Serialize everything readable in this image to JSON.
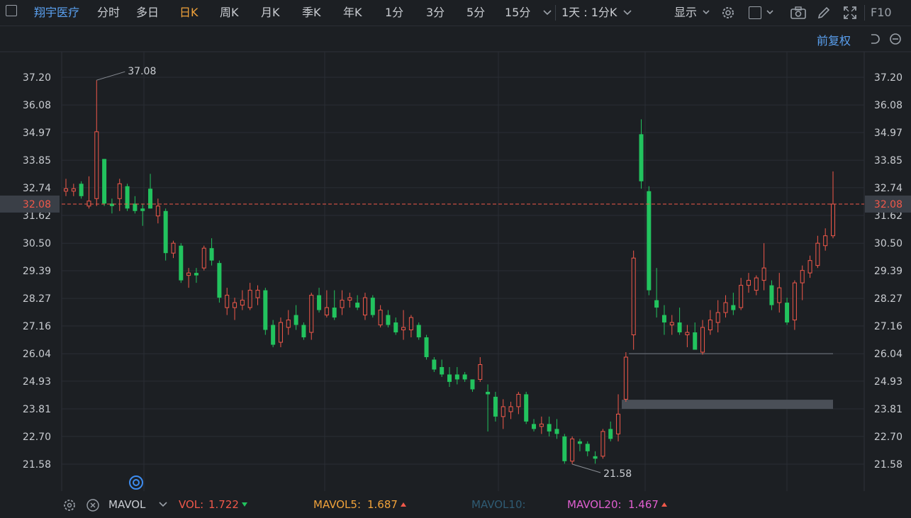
{
  "toolbar": {
    "stock_name": "翔宇医疗",
    "periods": [
      "分时",
      "多日",
      "日K",
      "周K",
      "月K",
      "季K",
      "年K",
      "1分",
      "3分",
      "5分",
      "15分"
    ],
    "active_period": "日K",
    "interval": "1天 : 1分K",
    "display_label": "显示",
    "f10_label": "F10"
  },
  "adjust_label": "前复权",
  "colors": {
    "background": "#1c1f23",
    "up": "#f0584a",
    "down": "#22c35e",
    "grid": "#2a2e34",
    "current_price": "#f0584a",
    "accent": "#f0a23a",
    "link": "#5aa0f0"
  },
  "chart_data": {
    "type": "candlestick",
    "y_ticks": [
      "37.20",
      "36.08",
      "34.97",
      "33.85",
      "32.74",
      "31.62",
      "30.50",
      "29.39",
      "28.27",
      "27.16",
      "26.04",
      "24.93",
      "23.81",
      "22.70",
      "21.58"
    ],
    "ylim": [
      20.7,
      38.3
    ],
    "current_price": "32.08",
    "high_label": "37.08",
    "low_label": "21.58",
    "support_bands": [
      [
        26.03,
        26.06
      ],
      [
        23.81,
        24.18
      ]
    ],
    "candles": [
      {
        "o": 32.6,
        "h": 33.1,
        "l": 32.4,
        "c": 32.7
      },
      {
        "o": 32.6,
        "h": 32.9,
        "l": 32.4,
        "c": 32.7
      },
      {
        "o": 32.9,
        "h": 33.0,
        "l": 32.3,
        "c": 32.4
      },
      {
        "o": 32.0,
        "h": 33.2,
        "l": 31.9,
        "c": 32.2
      },
      {
        "o": 32.3,
        "h": 37.08,
        "l": 32.0,
        "c": 35.0
      },
      {
        "o": 33.9,
        "h": 33.9,
        "l": 32.0,
        "c": 32.1
      },
      {
        "o": 32.1,
        "h": 32.3,
        "l": 31.7,
        "c": 32.0
      },
      {
        "o": 32.3,
        "h": 33.1,
        "l": 31.8,
        "c": 32.9
      },
      {
        "o": 32.8,
        "h": 32.9,
        "l": 31.8,
        "c": 31.9
      },
      {
        "o": 32.1,
        "h": 32.4,
        "l": 31.7,
        "c": 31.8
      },
      {
        "o": 31.9,
        "h": 32.1,
        "l": 31.2,
        "c": 31.8
      },
      {
        "o": 32.7,
        "h": 33.3,
        "l": 31.9,
        "c": 31.9
      },
      {
        "o": 31.6,
        "h": 32.3,
        "l": 31.3,
        "c": 32.0
      },
      {
        "o": 31.8,
        "h": 31.9,
        "l": 29.8,
        "c": 30.1
      },
      {
        "o": 30.1,
        "h": 30.6,
        "l": 29.9,
        "c": 30.5
      },
      {
        "o": 30.4,
        "h": 30.5,
        "l": 28.9,
        "c": 29.0
      },
      {
        "o": 29.2,
        "h": 29.5,
        "l": 28.7,
        "c": 29.3
      },
      {
        "o": 29.3,
        "h": 29.5,
        "l": 28.9,
        "c": 29.2
      },
      {
        "o": 29.5,
        "h": 30.4,
        "l": 29.4,
        "c": 30.3
      },
      {
        "o": 30.3,
        "h": 30.7,
        "l": 29.6,
        "c": 29.8
      },
      {
        "o": 29.7,
        "h": 29.8,
        "l": 28.1,
        "c": 28.3
      },
      {
        "o": 27.9,
        "h": 28.7,
        "l": 27.6,
        "c": 28.4
      },
      {
        "o": 27.9,
        "h": 28.3,
        "l": 27.4,
        "c": 28.1
      },
      {
        "o": 28.0,
        "h": 28.6,
        "l": 27.8,
        "c": 28.2
      },
      {
        "o": 27.9,
        "h": 28.9,
        "l": 27.8,
        "c": 28.6
      },
      {
        "o": 28.3,
        "h": 28.8,
        "l": 28.0,
        "c": 28.6
      },
      {
        "o": 28.6,
        "h": 28.7,
        "l": 26.8,
        "c": 27.0
      },
      {
        "o": 27.2,
        "h": 27.4,
        "l": 26.3,
        "c": 26.4
      },
      {
        "o": 26.5,
        "h": 27.5,
        "l": 26.3,
        "c": 27.3
      },
      {
        "o": 27.1,
        "h": 27.8,
        "l": 26.8,
        "c": 27.4
      },
      {
        "o": 27.6,
        "h": 28.0,
        "l": 27.0,
        "c": 27.2
      },
      {
        "o": 27.2,
        "h": 27.3,
        "l": 26.6,
        "c": 26.7
      },
      {
        "o": 26.9,
        "h": 28.5,
        "l": 26.6,
        "c": 28.4
      },
      {
        "o": 28.4,
        "h": 28.7,
        "l": 27.7,
        "c": 27.8
      },
      {
        "o": 27.6,
        "h": 28.6,
        "l": 27.5,
        "c": 27.9
      },
      {
        "o": 27.9,
        "h": 28.6,
        "l": 27.4,
        "c": 27.5
      },
      {
        "o": 27.9,
        "h": 28.6,
        "l": 27.6,
        "c": 28.2
      },
      {
        "o": 28.2,
        "h": 28.5,
        "l": 27.9,
        "c": 28.3
      },
      {
        "o": 28.1,
        "h": 28.4,
        "l": 27.8,
        "c": 27.9
      },
      {
        "o": 27.6,
        "h": 28.5,
        "l": 27.4,
        "c": 28.3
      },
      {
        "o": 28.3,
        "h": 28.4,
        "l": 27.5,
        "c": 27.6
      },
      {
        "o": 27.2,
        "h": 28.0,
        "l": 27.1,
        "c": 27.8
      },
      {
        "o": 27.6,
        "h": 27.8,
        "l": 27.1,
        "c": 27.2
      },
      {
        "o": 27.3,
        "h": 27.5,
        "l": 26.8,
        "c": 26.9
      },
      {
        "o": 27.0,
        "h": 27.8,
        "l": 26.6,
        "c": 27.1
      },
      {
        "o": 27.0,
        "h": 27.6,
        "l": 26.7,
        "c": 27.5
      },
      {
        "o": 27.2,
        "h": 27.3,
        "l": 26.6,
        "c": 26.7
      },
      {
        "o": 26.7,
        "h": 26.8,
        "l": 25.8,
        "c": 25.9
      },
      {
        "o": 25.8,
        "h": 25.9,
        "l": 25.3,
        "c": 25.4
      },
      {
        "o": 25.5,
        "h": 25.8,
        "l": 25.1,
        "c": 25.2
      },
      {
        "o": 25.2,
        "h": 25.5,
        "l": 24.7,
        "c": 24.9
      },
      {
        "o": 25.2,
        "h": 25.5,
        "l": 24.8,
        "c": 25.0
      },
      {
        "o": 25.2,
        "h": 25.3,
        "l": 24.9,
        "c": 25.0
      },
      {
        "o": 25.0,
        "h": 25.0,
        "l": 24.5,
        "c": 24.6
      },
      {
        "o": 25.0,
        "h": 25.9,
        "l": 24.9,
        "c": 25.6
      },
      {
        "o": 24.5,
        "h": 24.8,
        "l": 22.9,
        "c": 24.4
      },
      {
        "o": 24.3,
        "h": 24.5,
        "l": 23.3,
        "c": 23.5
      },
      {
        "o": 23.5,
        "h": 24.2,
        "l": 23.0,
        "c": 23.9
      },
      {
        "o": 23.7,
        "h": 24.1,
        "l": 23.4,
        "c": 23.9
      },
      {
        "o": 23.9,
        "h": 24.5,
        "l": 23.6,
        "c": 24.4
      },
      {
        "o": 24.4,
        "h": 24.5,
        "l": 23.2,
        "c": 23.3
      },
      {
        "o": 23.2,
        "h": 23.4,
        "l": 22.9,
        "c": 23.0
      },
      {
        "o": 23.1,
        "h": 23.5,
        "l": 22.8,
        "c": 23.2
      },
      {
        "o": 23.2,
        "h": 23.5,
        "l": 22.7,
        "c": 22.9
      },
      {
        "o": 23.0,
        "h": 23.4,
        "l": 22.6,
        "c": 22.8
      },
      {
        "o": 22.7,
        "h": 22.8,
        "l": 21.6,
        "c": 21.7
      },
      {
        "o": 21.7,
        "h": 22.7,
        "l": 21.58,
        "c": 22.6
      },
      {
        "o": 22.5,
        "h": 22.6,
        "l": 22.1,
        "c": 22.4
      },
      {
        "o": 22.4,
        "h": 22.5,
        "l": 21.9,
        "c": 22.1
      },
      {
        "o": 21.9,
        "h": 22.1,
        "l": 21.6,
        "c": 21.8
      },
      {
        "o": 21.9,
        "h": 23.0,
        "l": 21.8,
        "c": 22.9
      },
      {
        "o": 23.0,
        "h": 23.3,
        "l": 22.5,
        "c": 22.6
      },
      {
        "o": 22.8,
        "h": 24.4,
        "l": 22.5,
        "c": 23.6
      },
      {
        "o": 24.2,
        "h": 26.1,
        "l": 24.1,
        "c": 25.9
      },
      {
        "o": 26.8,
        "h": 30.2,
        "l": 26.2,
        "c": 29.9
      },
      {
        "o": 34.9,
        "h": 35.5,
        "l": 32.7,
        "c": 33.0
      },
      {
        "o": 32.6,
        "h": 32.8,
        "l": 28.4,
        "c": 28.6
      },
      {
        "o": 28.2,
        "h": 29.5,
        "l": 27.5,
        "c": 27.9
      },
      {
        "o": 27.6,
        "h": 28.0,
        "l": 26.8,
        "c": 27.3
      },
      {
        "o": 27.2,
        "h": 27.6,
        "l": 26.8,
        "c": 27.3
      },
      {
        "o": 27.3,
        "h": 27.9,
        "l": 26.8,
        "c": 26.9
      },
      {
        "o": 26.8,
        "h": 27.2,
        "l": 26.3,
        "c": 26.9
      },
      {
        "o": 26.9,
        "h": 27.3,
        "l": 26.2,
        "c": 26.2
      },
      {
        "o": 26.1,
        "h": 27.4,
        "l": 26.0,
        "c": 27.1
      },
      {
        "o": 27.0,
        "h": 27.8,
        "l": 26.8,
        "c": 27.4
      },
      {
        "o": 27.3,
        "h": 28.2,
        "l": 26.9,
        "c": 27.7
      },
      {
        "o": 27.7,
        "h": 28.4,
        "l": 27.5,
        "c": 28.1
      },
      {
        "o": 28.0,
        "h": 28.5,
        "l": 27.6,
        "c": 27.8
      },
      {
        "o": 27.9,
        "h": 29.1,
        "l": 27.8,
        "c": 28.8
      },
      {
        "o": 28.8,
        "h": 29.3,
        "l": 28.5,
        "c": 29.0
      },
      {
        "o": 28.6,
        "h": 29.2,
        "l": 28.4,
        "c": 29.1
      },
      {
        "o": 29.0,
        "h": 30.5,
        "l": 28.6,
        "c": 29.5
      },
      {
        "o": 28.8,
        "h": 29.0,
        "l": 27.8,
        "c": 28.0
      },
      {
        "o": 28.1,
        "h": 29.3,
        "l": 27.7,
        "c": 28.7
      },
      {
        "o": 28.1,
        "h": 28.3,
        "l": 27.2,
        "c": 27.3
      },
      {
        "o": 27.4,
        "h": 29.0,
        "l": 27.0,
        "c": 28.9
      },
      {
        "o": 28.9,
        "h": 29.6,
        "l": 28.2,
        "c": 29.4
      },
      {
        "o": 29.3,
        "h": 30.0,
        "l": 29.1,
        "c": 29.8
      },
      {
        "o": 29.6,
        "h": 30.8,
        "l": 29.5,
        "c": 30.5
      },
      {
        "o": 30.4,
        "h": 31.1,
        "l": 30.2,
        "c": 30.8
      },
      {
        "o": 30.8,
        "h": 33.4,
        "l": 30.7,
        "c": 32.08
      }
    ]
  },
  "indicator": {
    "name": "MAVOL",
    "vol_label": "VOL:",
    "vol_value": "1.722",
    "mavol5_label": "MAVOL5:",
    "mavol5_value": "1.687",
    "mavol10_label": "MAVOL10:",
    "mavol20_label": "MAVOL20:",
    "mavol20_value": "1.467"
  }
}
